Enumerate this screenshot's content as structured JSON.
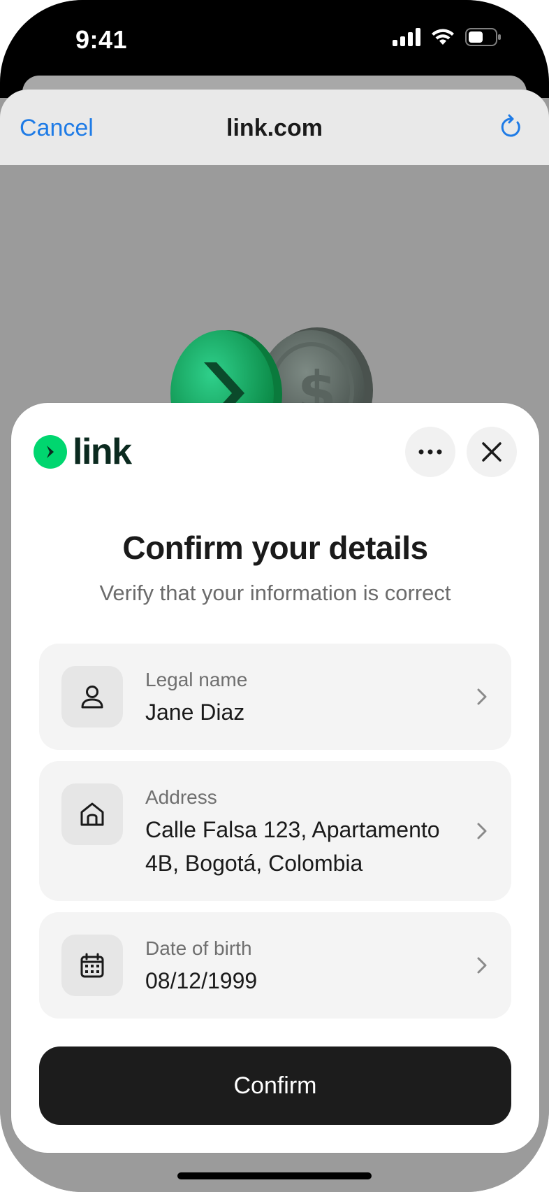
{
  "status_bar": {
    "time": "9:41"
  },
  "browser": {
    "cancel_label": "Cancel",
    "url": "link.com"
  },
  "modal": {
    "logo_text": "link",
    "title": "Confirm your details",
    "subtitle": "Verify that your information is correct",
    "fields": [
      {
        "label": "Legal name",
        "value": "Jane Diaz",
        "icon": "person-icon"
      },
      {
        "label": "Address",
        "value": "Calle Falsa 123, Apartamento 4B, Bogotá, Colombia",
        "icon": "home-icon"
      },
      {
        "label": "Date of birth",
        "value": "08/12/1999",
        "icon": "calendar-icon"
      }
    ],
    "confirm_label": "Confirm"
  },
  "colors": {
    "brand_green": "#00d66f",
    "link_blue": "#1e7be6",
    "button_dark": "#1c1c1c"
  }
}
